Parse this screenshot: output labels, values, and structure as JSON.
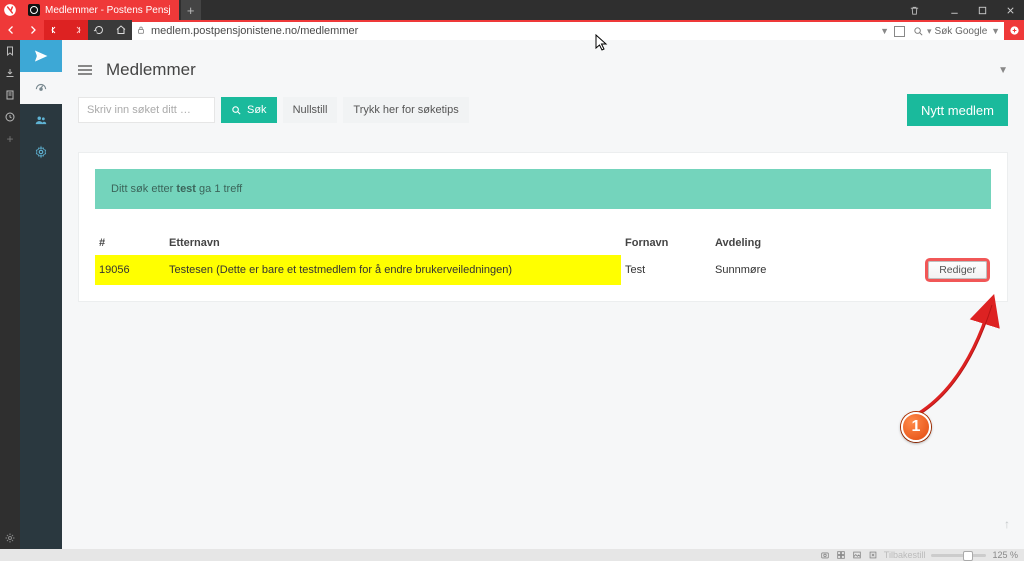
{
  "browser": {
    "tab_title": "Medlemmer - Postens Pensj",
    "url": "medlem.postpensjonistene.no/medlemmer",
    "search_placeholder": "Søk Google",
    "zoom": "125 %",
    "status_reset": "Tilbakestill"
  },
  "page": {
    "title": "Medlemmer",
    "search_placeholder": "Skriv inn søket ditt …",
    "btn_search": "Søk",
    "btn_reset": "Nullstill",
    "btn_tips": "Trykk her for søketips",
    "btn_new": "Nytt medlem",
    "result_prefix": "Ditt søk etter ",
    "result_term": "test",
    "result_suffix": " ga 1 treff",
    "columns": {
      "id": "#",
      "lastname": "Etternavn",
      "firstname": "Fornavn",
      "dept": "Avdeling"
    },
    "row": {
      "id": "19056",
      "lastname": "Testesen (Dette er bare et testmedlem for å endre brukerveiledningen)",
      "firstname": "Test",
      "dept": "Sunnmøre",
      "edit": "Rediger"
    }
  },
  "annotation": {
    "badge": "1"
  }
}
